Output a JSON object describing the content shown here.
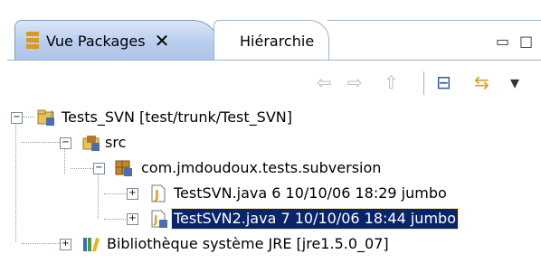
{
  "tabs": [
    {
      "label": "Vue Packages",
      "close": "✕"
    },
    {
      "label": "Hiérarchie"
    }
  ],
  "window_controls": {
    "minimize": "▭",
    "maximize": "□"
  },
  "toolbar": {
    "back": "⇦",
    "forward": "⇨",
    "up": "⇧",
    "collapse": "⊟",
    "link": "⇆",
    "menu": "▾"
  },
  "tree": {
    "project": {
      "label": "Tests_SVN [test/trunk/Test_SVN]"
    },
    "src": {
      "label": "src"
    },
    "package": {
      "label": "com.jmdoudoux.tests.subversion"
    },
    "file1": {
      "label": "TestSVN.java 6  10/10/06 18:29  jumbo"
    },
    "file2": {
      "label": "TestSVN2.java 7  10/10/06 18:44  jumbo"
    },
    "library": {
      "label": "Bibliothèque système JRE [jre1.5.0_07]"
    }
  },
  "colors": {
    "selection": "#0a246a",
    "tab_active": "#b9cdee",
    "package_icon": "#d99a20"
  }
}
